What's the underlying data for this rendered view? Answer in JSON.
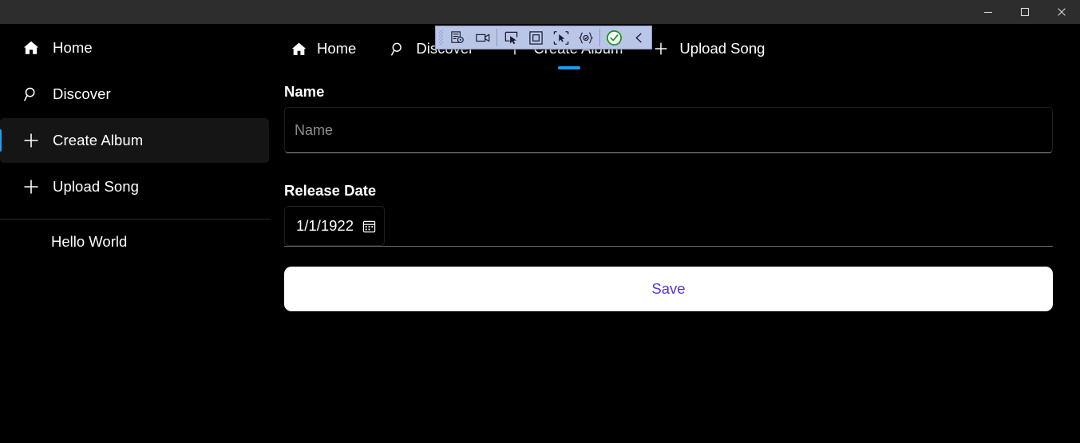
{
  "window": {
    "title": "",
    "controls": [
      {
        "name": "minimize",
        "glyph": "minimize-icon",
        "label": "Minimize"
      },
      {
        "name": "maximize",
        "glyph": "maximize-icon",
        "label": "Maximize"
      },
      {
        "name": "close",
        "glyph": "close-icon",
        "label": "Close"
      }
    ]
  },
  "sidebar": {
    "items": [
      {
        "label": "Home",
        "icon": "home-icon",
        "selected": false
      },
      {
        "label": "Discover",
        "icon": "search-icon",
        "selected": false
      },
      {
        "label": "Create Album",
        "icon": "plus-icon",
        "selected": true
      },
      {
        "label": "Upload Song",
        "icon": "plus-icon",
        "selected": false
      }
    ],
    "extra_items": [
      {
        "label": "Hello World"
      }
    ],
    "accent_color": "#1f9cf0",
    "selected_bg": "#151515"
  },
  "topnav": {
    "tabs": [
      {
        "label": "Home",
        "icon": "home-icon",
        "active": false
      },
      {
        "label": "Discover",
        "icon": "search-icon",
        "active": false
      },
      {
        "label": "Create Album",
        "icon": "plus-icon",
        "active": true
      },
      {
        "label": "Upload Song",
        "icon": "plus-icon",
        "active": false
      }
    ],
    "indicator_color": "#1f9cf0"
  },
  "form": {
    "name": {
      "label": "Name",
      "value": "",
      "placeholder": "Name"
    },
    "release_date": {
      "label": "Release Date",
      "value": "1/1/1922",
      "icon": "calendar-icon"
    },
    "save": {
      "label": "Save",
      "text_color": "#5433e8",
      "background": "#ffffff"
    }
  },
  "debug_toolbar": {
    "background": "#b9c6e8",
    "buttons": [
      {
        "name": "grip",
        "icon": "drag-handle-icon"
      },
      {
        "name": "inspect-properties",
        "icon": "live-property-explorer-icon"
      },
      {
        "name": "record",
        "icon": "camera-icon"
      },
      {
        "name": "select-element",
        "icon": "pointer-select-icon"
      },
      {
        "name": "layout-frame",
        "icon": "frame-square-icon"
      },
      {
        "name": "element-picker",
        "icon": "element-picker-icon"
      },
      {
        "name": "code-braces",
        "icon": "braces-check-icon"
      },
      {
        "name": "accept",
        "icon": "check-circle-icon"
      },
      {
        "name": "collapse",
        "icon": "chevron-left-icon"
      }
    ]
  }
}
